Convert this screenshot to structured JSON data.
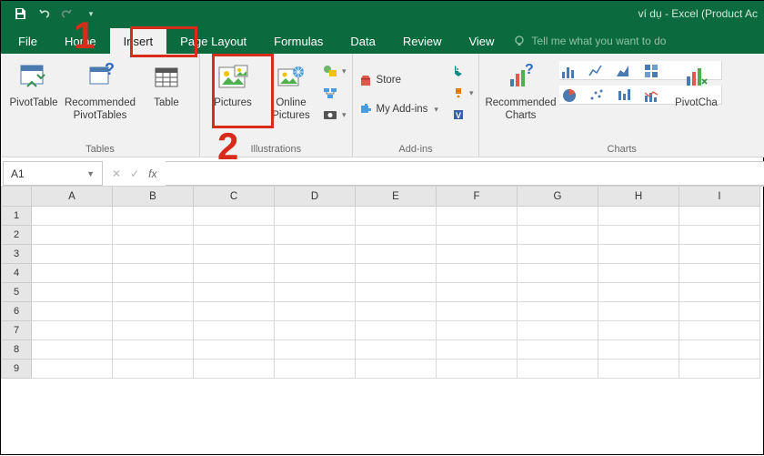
{
  "title": "ví dụ - Excel (Product Ac",
  "tabs": {
    "file": "File",
    "home": "Home",
    "insert": "Insert",
    "pageLayout": "Page Layout",
    "formulas": "Formulas",
    "data": "Data",
    "review": "Review",
    "view": "View",
    "tell": "Tell me what you want to do"
  },
  "ribbon": {
    "tables": {
      "pivot": "PivotTable",
      "recPivot": "Recommended\nPivotTables",
      "table": "Table",
      "group": "Tables"
    },
    "illus": {
      "pictures": "Pictures",
      "online": "Online\nPictures",
      "group": "Illustrations"
    },
    "addins": {
      "store": "Store",
      "myaddins": "My Add-ins",
      "group": "Add-ins"
    },
    "charts": {
      "rec": "Recommended\nCharts",
      "pivotchart": "PivotCha",
      "group": "Charts"
    }
  },
  "namebox": "A1",
  "fx": "fx",
  "columns": [
    "A",
    "B",
    "C",
    "D",
    "E",
    "F",
    "G",
    "H",
    "I"
  ],
  "rows": [
    "1",
    "2",
    "3",
    "4",
    "5",
    "6",
    "7",
    "8",
    "9"
  ],
  "ann": {
    "one": "1",
    "two": "2"
  }
}
